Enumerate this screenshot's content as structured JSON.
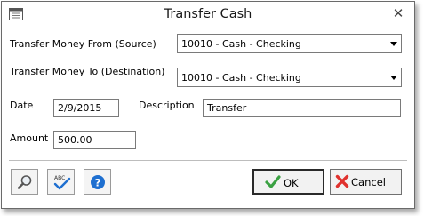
{
  "window": {
    "title": "Transfer Cash",
    "close_glyph": "✕"
  },
  "form": {
    "from_label": "Transfer Money From (Source)",
    "from_value": "10010 - Cash - Checking",
    "to_label": "Transfer Money To (Destination)",
    "to_value": "10010 - Cash - Checking",
    "date_label": "Date",
    "date_value": "2/9/2015",
    "description_label": "Description",
    "description_value": "Transfer",
    "amount_label": "Amount",
    "amount_value": "500.00"
  },
  "footer": {
    "search_icon": "magnifier-icon",
    "spellcheck_icon": "spellcheck-icon",
    "spellcheck_text": "ABC",
    "help_icon": "help-icon",
    "help_text": "?",
    "ok_label": "OK",
    "cancel_label": "Cancel"
  },
  "colors": {
    "ok_check": "#3aa142",
    "cancel_x": "#e0322e",
    "help_blue": "#1e6fd0"
  }
}
